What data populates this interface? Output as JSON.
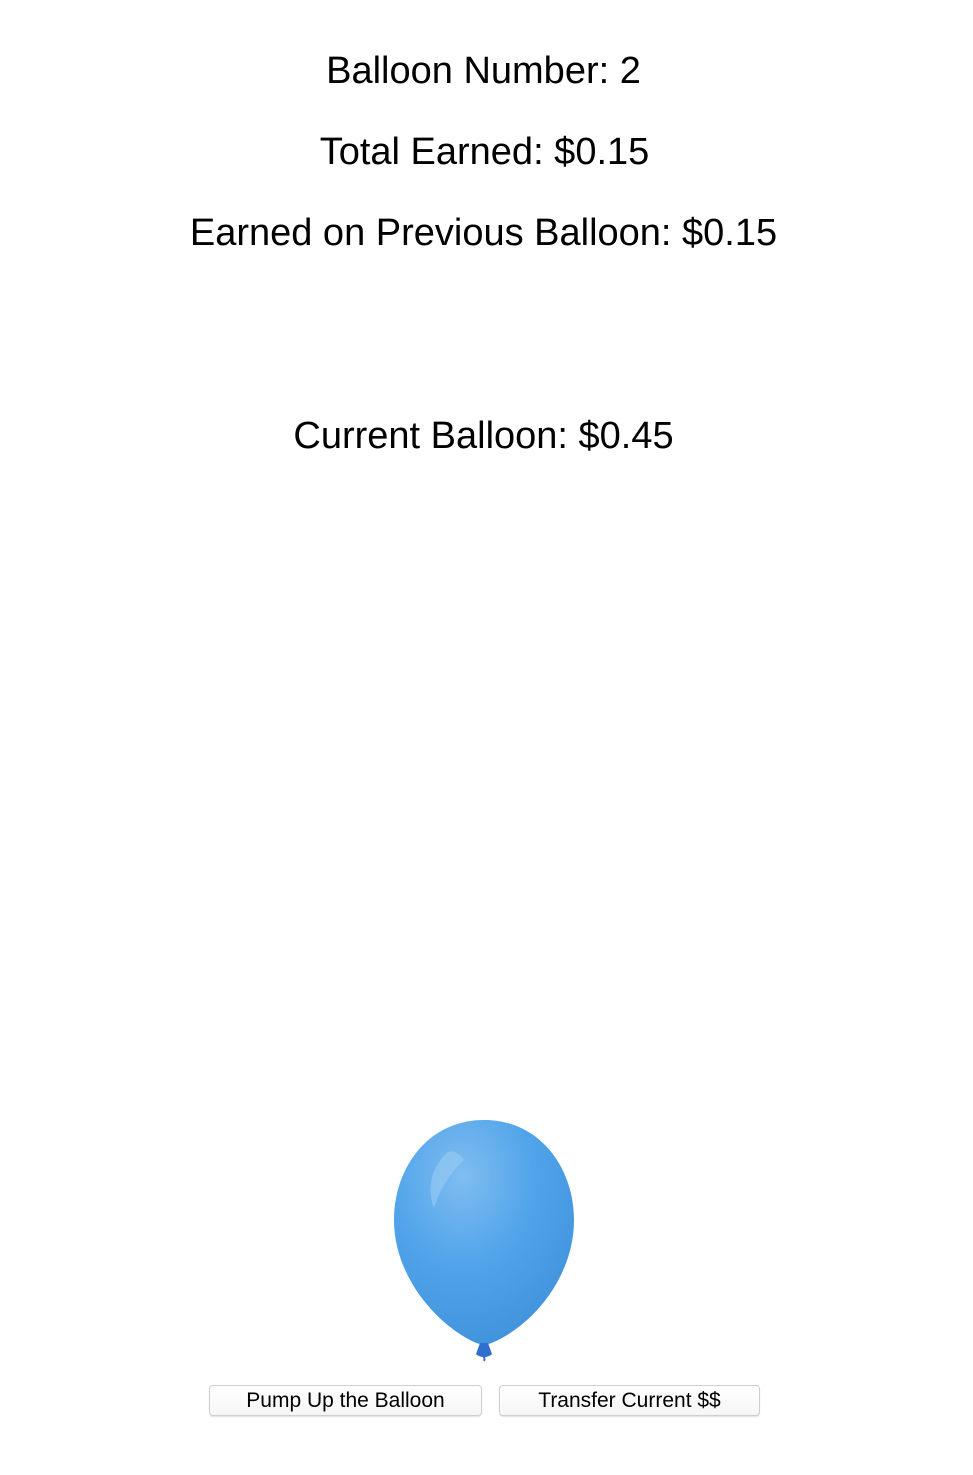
{
  "stats": {
    "balloon_number": "Balloon Number: 2",
    "total_earned": "Total Earned: $0.15",
    "earned_previous": "Earned on Previous Balloon: $0.15",
    "current_balloon": "Current Balloon: $0.45"
  },
  "balloon": {
    "icon": "balloon-icon",
    "color": "#4fa3e8"
  },
  "buttons": {
    "pump_label": "Pump Up the Balloon",
    "transfer_label": "Transfer Current $$"
  }
}
